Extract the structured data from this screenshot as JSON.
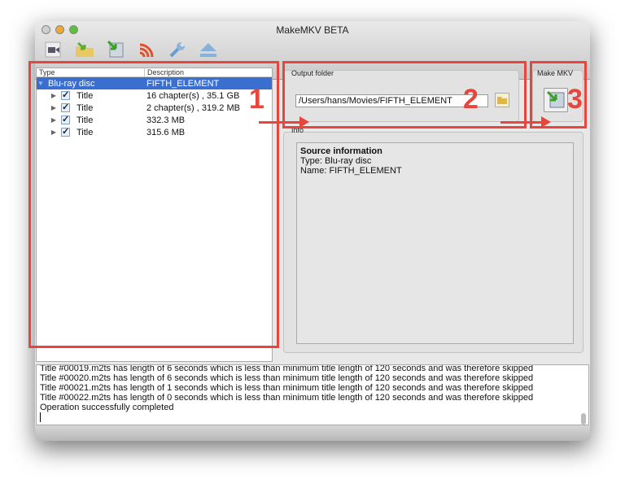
{
  "window": {
    "title": "MakeMKV BETA"
  },
  "toolbar": [
    "open-files-icon",
    "open-folder-icon",
    "make-mkv-icon",
    "stream-icon",
    "settings-icon",
    "eject-icon"
  ],
  "tree": {
    "headers": {
      "type": "Type",
      "description": "Description"
    },
    "root": {
      "type": "Blu-ray disc",
      "description": "FIFTH_ELEMENT"
    },
    "items": [
      {
        "type": "Title",
        "description": "16 chapter(s) , 35.1 GB",
        "checked": true
      },
      {
        "type": "Title",
        "description": "2 chapter(s) , 319.2 MB",
        "checked": true
      },
      {
        "type": "Title",
        "description": "332.3 MB",
        "checked": true
      },
      {
        "type": "Title",
        "description": "315.6 MB",
        "checked": true
      }
    ]
  },
  "output": {
    "label": "Output folder",
    "path": "/Users/hans/Movies/FIFTH_ELEMENT"
  },
  "makemkv": {
    "label": "Make MKV"
  },
  "info": {
    "label": "Info",
    "heading": "Source information",
    "type": "Type: Blu-ray disc",
    "name": "Name: FIFTH_ELEMENT"
  },
  "log": [
    "Title #00019.m2ts has length of 6 seconds which is less than minimum title length of 120 seconds and was therefore skipped",
    "Title #00020.m2ts has length of 6 seconds which is less than minimum title length of 120 seconds and was therefore skipped",
    "Title #00021.m2ts has length of 1 seconds which is less than minimum title length of 120 seconds and was therefore skipped",
    "Title #00022.m2ts has length of 0 seconds which is less than minimum title length of 120 seconds and was therefore skipped",
    "Operation successfully completed"
  ],
  "annotations": {
    "n1": "1",
    "n2": "2",
    "n3": "3",
    "color": "#e8453c"
  }
}
